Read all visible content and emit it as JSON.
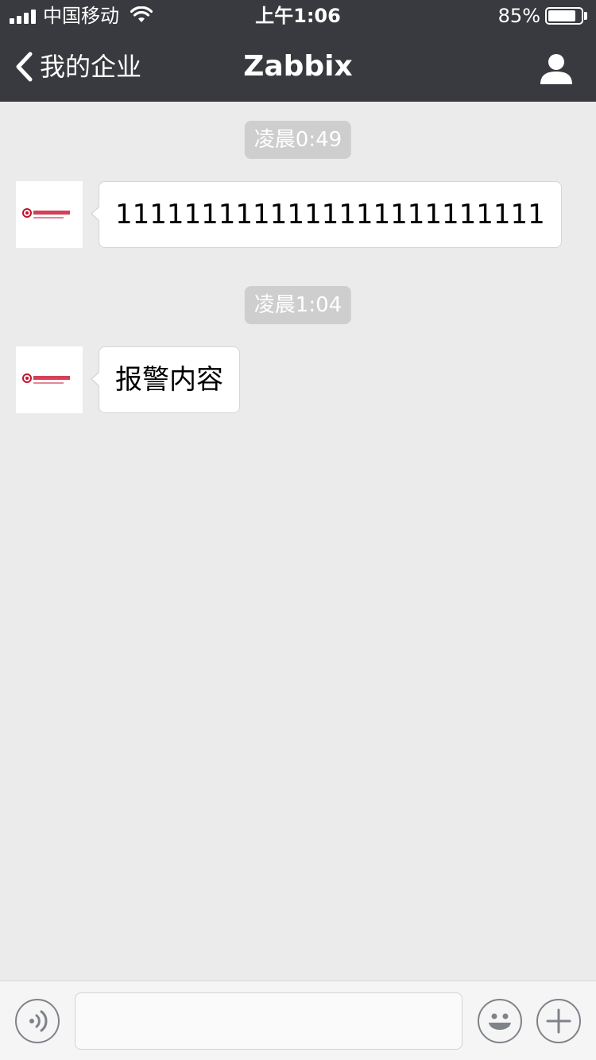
{
  "status_bar": {
    "carrier": "中国移动",
    "time": "上午1:06",
    "battery_percent_label": "85%",
    "battery_level": 0.85
  },
  "nav": {
    "back_label": "我的企业",
    "title": "Zabbix"
  },
  "messages": [
    {
      "timestamp": "凌晨0:49",
      "text": "1111111111111111111111111"
    },
    {
      "timestamp": "凌晨1:04",
      "text": "报警内容"
    }
  ],
  "input": {
    "value": ""
  },
  "colors": {
    "header_bg": "#393a3f",
    "chat_bg": "#ebebeb",
    "time_pill_bg": "#cecece",
    "bubble_bg": "#ffffff",
    "input_bar_bg": "#f5f5f6",
    "icon_gray": "#7f8389",
    "avatar_logo_red": "#c8102e"
  },
  "icons": {
    "signal": "signal-icon",
    "wifi": "wifi-icon",
    "battery": "battery-icon",
    "back": "chevron-left-icon",
    "profile": "person-icon",
    "voice": "voice-icon",
    "emoji": "smiley-icon",
    "plus": "plus-icon"
  }
}
